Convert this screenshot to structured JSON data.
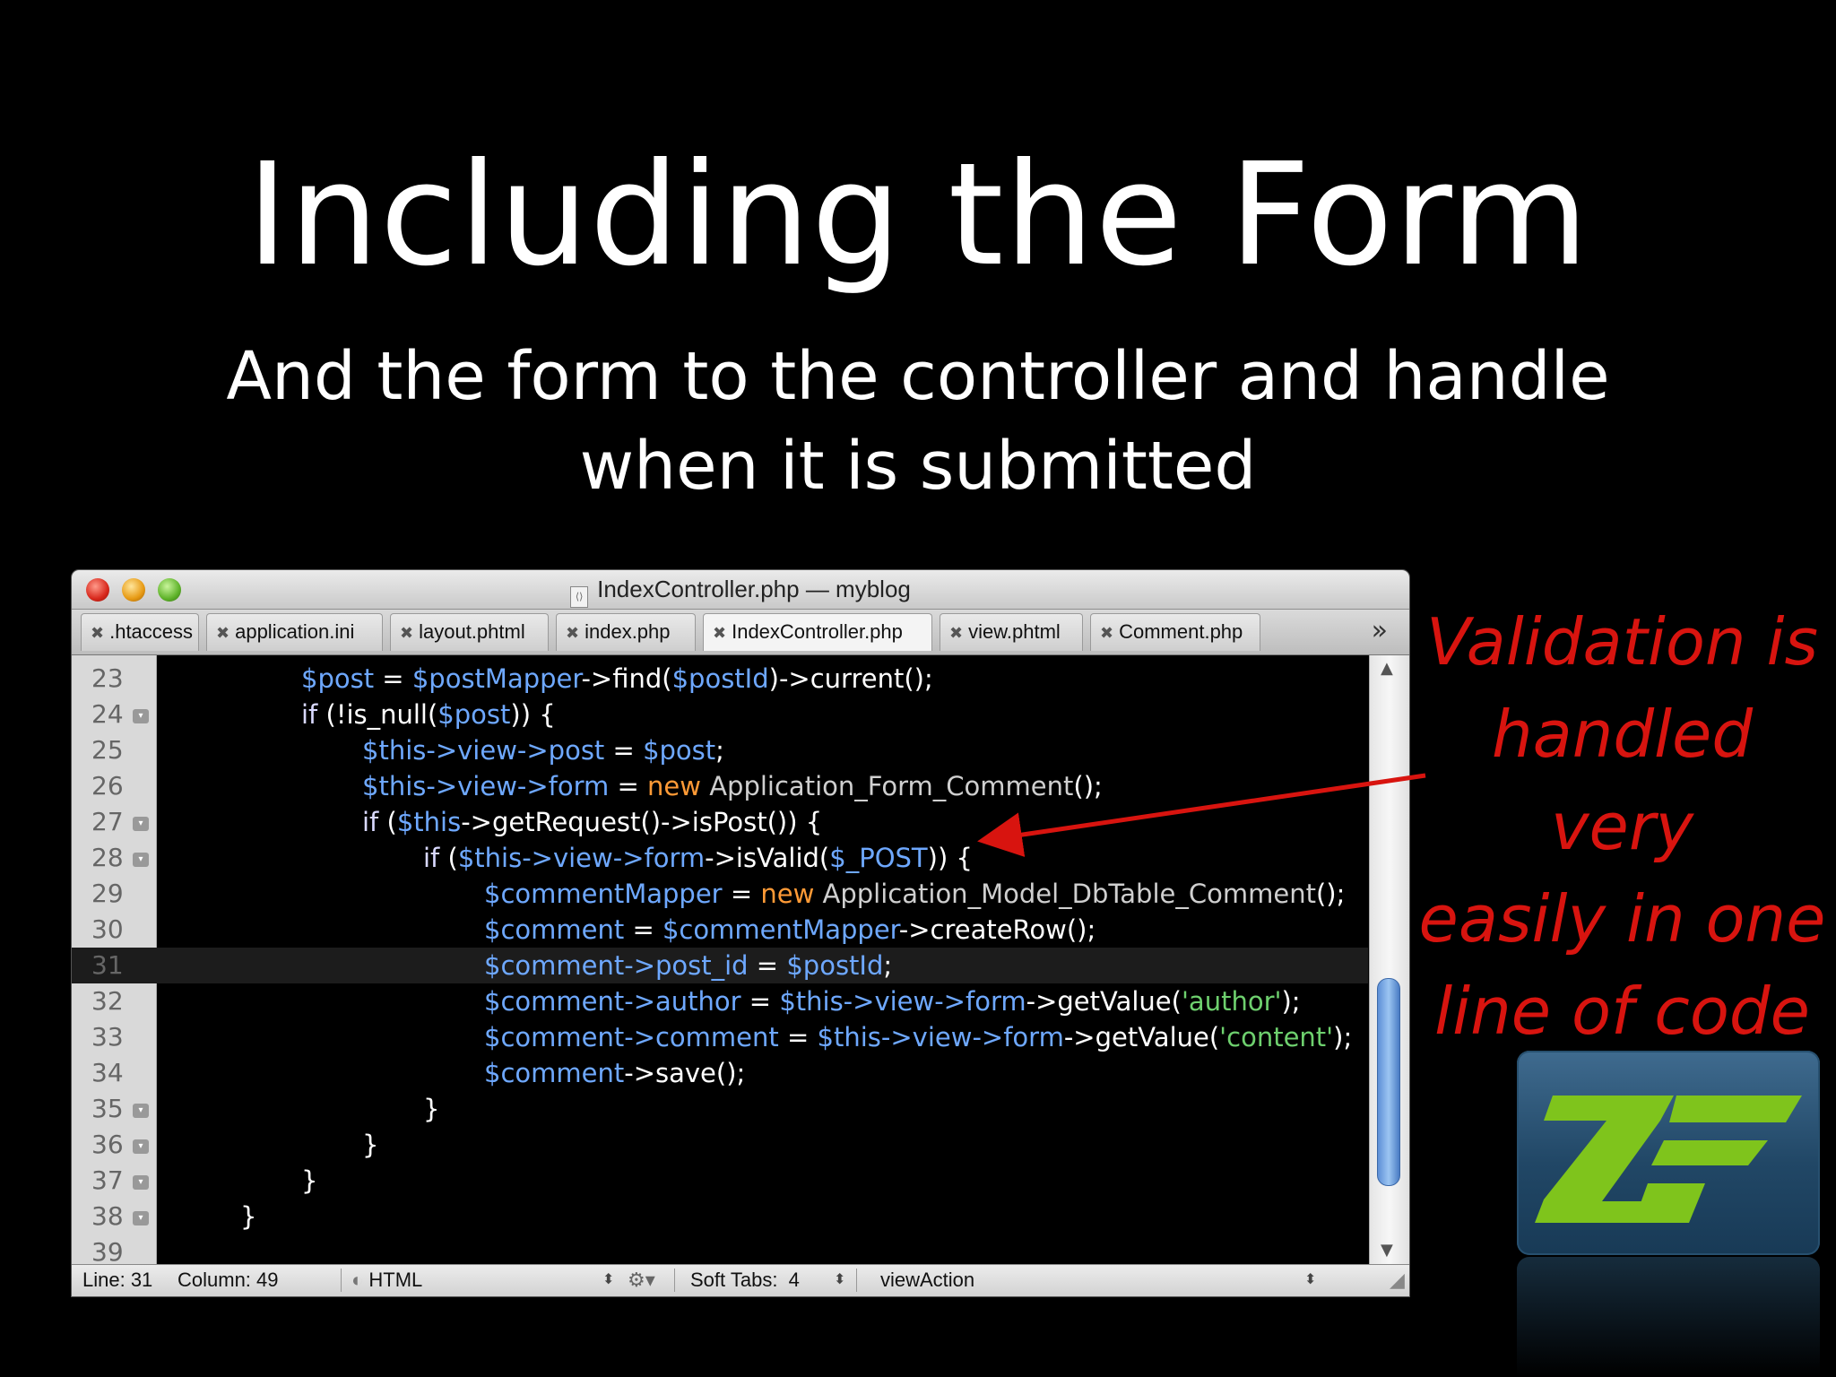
{
  "slide": {
    "title": "Including the Form",
    "subtitle_line1": "And the form to the controller and handle",
    "subtitle_line2": "when it is submitted",
    "annotation": [
      "Validation is",
      "handled very",
      "easily in one",
      "line of code"
    ],
    "annotation_color": "#d8140f"
  },
  "window": {
    "title": "IndexController.php — myblog",
    "tabs": [
      ".htaccess",
      "application.ini",
      "layout.phtml",
      "index.php",
      "IndexController.php",
      "view.phtml",
      "Comment.php"
    ],
    "active_tab": "IndexController.php",
    "overflow_icon": "double-chevron-right-icon"
  },
  "code": {
    "current_line": 31,
    "lines": [
      {
        "n": "23",
        "fold": false,
        "indent": 2,
        "tokens": [
          [
            "var",
            "$post"
          ],
          [
            "plain",
            " = "
          ],
          [
            "var",
            "$postMapper"
          ],
          [
            "plain",
            "->find("
          ],
          [
            "var",
            "$postId"
          ],
          [
            "plain",
            ")->current();"
          ]
        ]
      },
      {
        "n": "24",
        "fold": true,
        "indent": 2,
        "tokens": [
          [
            "ctl",
            "if"
          ],
          [
            "plain",
            " (!is_null("
          ],
          [
            "var",
            "$post"
          ],
          [
            "plain",
            ")) {"
          ]
        ]
      },
      {
        "n": "25",
        "fold": false,
        "indent": 3,
        "tokens": [
          [
            "var",
            "$this->view->post"
          ],
          [
            "plain",
            " = "
          ],
          [
            "var",
            "$post"
          ],
          [
            "plain",
            ";"
          ]
        ]
      },
      {
        "n": "26",
        "fold": false,
        "indent": 3,
        "tokens": [
          [
            "var",
            "$this->view->form"
          ],
          [
            "plain",
            " = "
          ],
          [
            "kw",
            "new"
          ],
          [
            "plain",
            " "
          ],
          [
            "cls",
            "Application_Form_Comment"
          ],
          [
            "plain",
            "();"
          ]
        ]
      },
      {
        "n": "27",
        "fold": true,
        "indent": 3,
        "tokens": [
          [
            "ctl",
            "if"
          ],
          [
            "plain",
            " ("
          ],
          [
            "var",
            "$this"
          ],
          [
            "plain",
            "->getRequest()->isPost()) {"
          ]
        ]
      },
      {
        "n": "28",
        "fold": true,
        "indent": 4,
        "tokens": [
          [
            "ctl",
            "if"
          ],
          [
            "plain",
            " ("
          ],
          [
            "var",
            "$this->view->form"
          ],
          [
            "plain",
            "->isValid("
          ],
          [
            "var",
            "$_POST"
          ],
          [
            "plain",
            ")) {"
          ]
        ]
      },
      {
        "n": "29",
        "fold": false,
        "indent": 5,
        "tokens": [
          [
            "var",
            "$commentMapper"
          ],
          [
            "plain",
            " = "
          ],
          [
            "kw",
            "new"
          ],
          [
            "plain",
            " "
          ],
          [
            "cls",
            "Application_Model_DbTable_Comment"
          ],
          [
            "plain",
            "();"
          ]
        ]
      },
      {
        "n": "30",
        "fold": false,
        "indent": 5,
        "tokens": [
          [
            "var",
            "$comment"
          ],
          [
            "plain",
            " = "
          ],
          [
            "var",
            "$commentMapper"
          ],
          [
            "plain",
            "->createRow();"
          ]
        ]
      },
      {
        "n": "31",
        "fold": false,
        "indent": 5,
        "tokens": [
          [
            "var",
            "$comment->post_id"
          ],
          [
            "plain",
            " = "
          ],
          [
            "var",
            "$postId"
          ],
          [
            "plain",
            ";"
          ]
        ]
      },
      {
        "n": "32",
        "fold": false,
        "indent": 5,
        "tokens": [
          [
            "var",
            "$comment->author"
          ],
          [
            "plain",
            " = "
          ],
          [
            "var",
            "$this->view->form"
          ],
          [
            "plain",
            "->getValue("
          ],
          [
            "str",
            "'author'"
          ],
          [
            "plain",
            ");"
          ]
        ]
      },
      {
        "n": "33",
        "fold": false,
        "indent": 5,
        "tokens": [
          [
            "var",
            "$comment->comment"
          ],
          [
            "plain",
            " = "
          ],
          [
            "var",
            "$this->view->form"
          ],
          [
            "plain",
            "->getValue("
          ],
          [
            "str",
            "'content'"
          ],
          [
            "plain",
            ");"
          ]
        ]
      },
      {
        "n": "34",
        "fold": false,
        "indent": 5,
        "tokens": [
          [
            "var",
            "$comment"
          ],
          [
            "plain",
            "->save();"
          ]
        ]
      },
      {
        "n": "35",
        "fold": true,
        "indent": 4,
        "tokens": [
          [
            "plain",
            "}"
          ]
        ]
      },
      {
        "n": "36",
        "fold": true,
        "indent": 3,
        "tokens": [
          [
            "plain",
            "}"
          ]
        ]
      },
      {
        "n": "37",
        "fold": true,
        "indent": 2,
        "tokens": [
          [
            "plain",
            "}"
          ]
        ]
      },
      {
        "n": "38",
        "fold": true,
        "indent": 1,
        "tokens": [
          [
            "plain",
            "}"
          ]
        ]
      },
      {
        "n": "39",
        "fold": false,
        "indent": 0,
        "tokens": []
      }
    ]
  },
  "statusbar": {
    "line": "Line: 31",
    "column": "Column: 49",
    "language": "HTML",
    "soft_tabs_label": "Soft Tabs:",
    "soft_tabs_value": "4",
    "symbol": "viewAction"
  },
  "colors": {
    "var": "#6ea8ff",
    "keyword": "#ff9a36",
    "string": "#6ed06e",
    "logo_green": "#7fc41c"
  }
}
